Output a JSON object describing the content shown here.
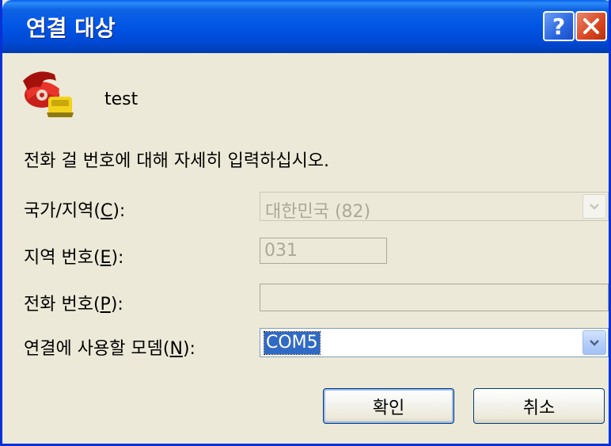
{
  "window": {
    "title": "연결 대상",
    "help_label": "?",
    "close_label": "✕"
  },
  "entry": {
    "name": "test",
    "icon": "telephone-icon"
  },
  "instructions": "전화 걸 번호에 대해 자세히 입력하십시오.",
  "fields": {
    "country": {
      "label_pre": "국가/지역(",
      "hotkey": "C",
      "label_post": "):",
      "value": "대한민국 (82)",
      "enabled": false
    },
    "area_code": {
      "label_pre": "지역 번호(",
      "hotkey": "E",
      "label_post": "):",
      "value": "031",
      "enabled": false
    },
    "phone_number": {
      "label_pre": "전화 번호(",
      "hotkey": "P",
      "label_post": "):",
      "value": "",
      "enabled": false
    },
    "modem": {
      "label_pre": "연결에 사용할 모뎀(",
      "hotkey": "N",
      "label_post": "):",
      "value": "COM5",
      "enabled": true
    }
  },
  "buttons": {
    "ok": "확인",
    "cancel": "취소"
  },
  "colors": {
    "titlebar": "#0055e5",
    "close_button": "#d8451e",
    "selection": "#316ac5",
    "dialog_bg": "#ece9d8"
  }
}
